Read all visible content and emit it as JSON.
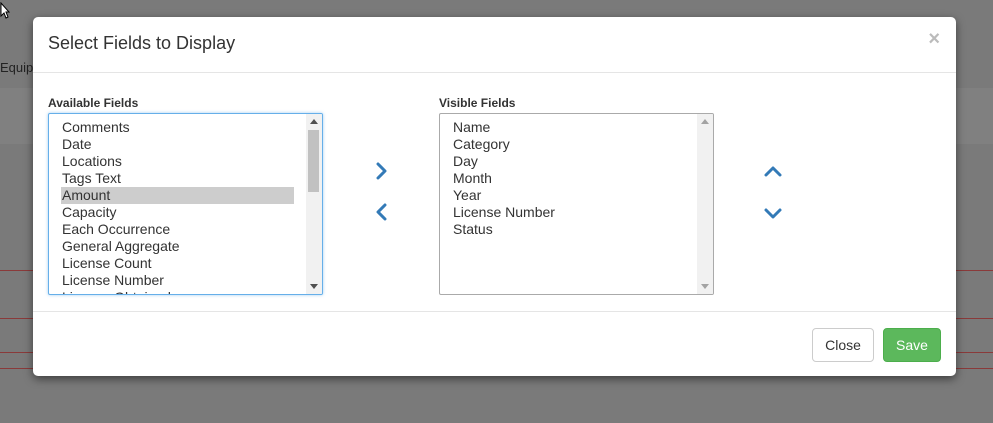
{
  "background": {
    "partial_text": "Equip"
  },
  "modal": {
    "title": "Select Fields to Display",
    "close_symbol": "×",
    "available_label": "Available Fields",
    "visible_label": "Visible Fields",
    "available_fields": [
      "Comments",
      "Date",
      "Locations",
      "Tags Text",
      "Amount",
      "Capacity",
      "Each Occurrence",
      "General Aggregate",
      "License Count",
      "License Number",
      "License Obtained"
    ],
    "available_selected": "Amount",
    "visible_fields": [
      "Name",
      "Category",
      "Day",
      "Month",
      "Year",
      "License Number",
      "Status"
    ],
    "icons": {
      "add": "chevron-right-icon",
      "remove": "chevron-left-icon",
      "move_up": "chevron-up-icon",
      "move_down": "chevron-down-icon"
    },
    "accent_color": "#337ab7",
    "footer": {
      "close_label": "Close",
      "save_label": "Save",
      "save_color": "#5cb85c"
    }
  }
}
